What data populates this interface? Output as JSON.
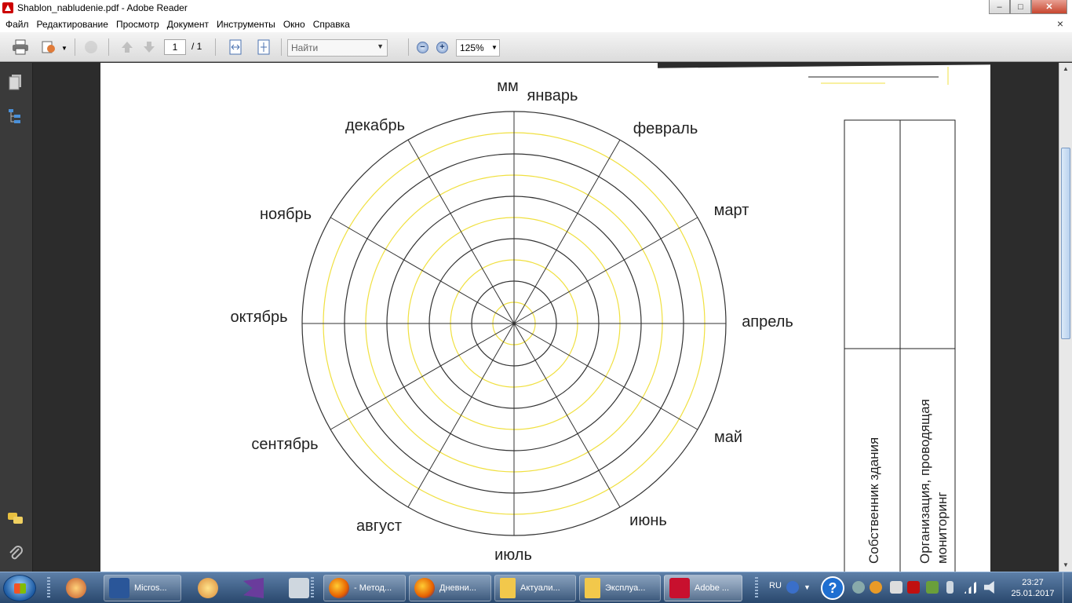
{
  "window": {
    "title": "Shablon_nabludenie.pdf - Adobe Reader",
    "controls": {
      "minimize": "–",
      "maximize": "□",
      "close": "✕"
    }
  },
  "menu": {
    "items": [
      "Файл",
      "Редактирование",
      "Просмотр",
      "Документ",
      "Инструменты",
      "Окно",
      "Справка"
    ],
    "close": "×"
  },
  "toolbar": {
    "page_current": "1",
    "page_total": "/ 1",
    "search_placeholder": "Найти",
    "zoom": "125%",
    "zoom_out": "−",
    "zoom_in": "+"
  },
  "document": {
    "chart_top_label": "мм",
    "months": [
      "январь",
      "февраль",
      "март",
      "апрель",
      "май",
      "июнь",
      "июль",
      "август",
      "сентябрь",
      "октябрь",
      "ноябрь",
      "декабрь"
    ],
    "table": {
      "col1_header": "Собственник здания",
      "col2_header": "Организация, проводящая мониторинг"
    }
  },
  "taskbar": {
    "apps": [
      {
        "label": "Micros...",
        "icon": "word-icon"
      },
      {
        "label": "- Метод...",
        "icon": "firefox-icon"
      },
      {
        "label": "Дневни...",
        "icon": "firefox-icon"
      },
      {
        "label": "Актуали...",
        "icon": "folder-icon"
      },
      {
        "label": "Эксплуа...",
        "icon": "folder-icon"
      },
      {
        "label": "Adobe ...",
        "icon": "adobe-reader-icon"
      }
    ],
    "language": "RU",
    "time": "23:27",
    "date": "25.01.2017"
  },
  "colors": {
    "ring_dark": "#333333",
    "ring_yellow": "#f0e040",
    "page_background": "#ffffff",
    "workspace": "#2c2c2c"
  }
}
